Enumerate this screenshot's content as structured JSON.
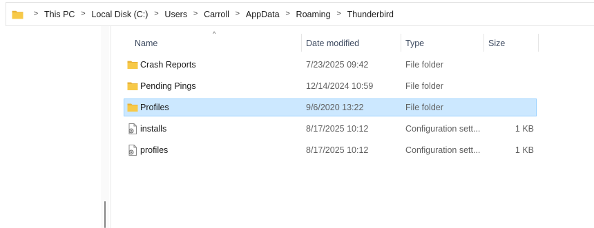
{
  "address_bar": {
    "crumbs": [
      "This PC",
      "Local Disk (C:)",
      "Users",
      "Carroll",
      "AppData",
      "Roaming",
      "Thunderbird"
    ],
    "separator": ">"
  },
  "columns": {
    "name": "Name",
    "date_modified": "Date modified",
    "type": "Type",
    "size": "Size",
    "sort_indicator": "^"
  },
  "files": [
    {
      "name": "Crash Reports",
      "date": "7/23/2025 09:42",
      "type": "File folder",
      "size": "",
      "icon": "folder-icon"
    },
    {
      "name": "Pending Pings",
      "date": "12/14/2024 10:59",
      "type": "File folder",
      "size": "",
      "icon": "folder-icon"
    },
    {
      "name": "Profiles",
      "date": "9/6/2020 13:22",
      "type": "File folder",
      "size": "",
      "icon": "folder-icon",
      "selected": true
    },
    {
      "name": "installs",
      "date": "8/17/2025 10:12",
      "type": "Configuration sett...",
      "size": "1 KB",
      "icon": "config-file-icon"
    },
    {
      "name": "profiles",
      "date": "8/17/2025 10:12",
      "type": "Configuration sett...",
      "size": "1 KB",
      "icon": "config-file-icon"
    }
  ],
  "colors": {
    "folder": "#f7c948",
    "selection_bg": "#cce8ff",
    "selection_border": "#99d1ff"
  }
}
